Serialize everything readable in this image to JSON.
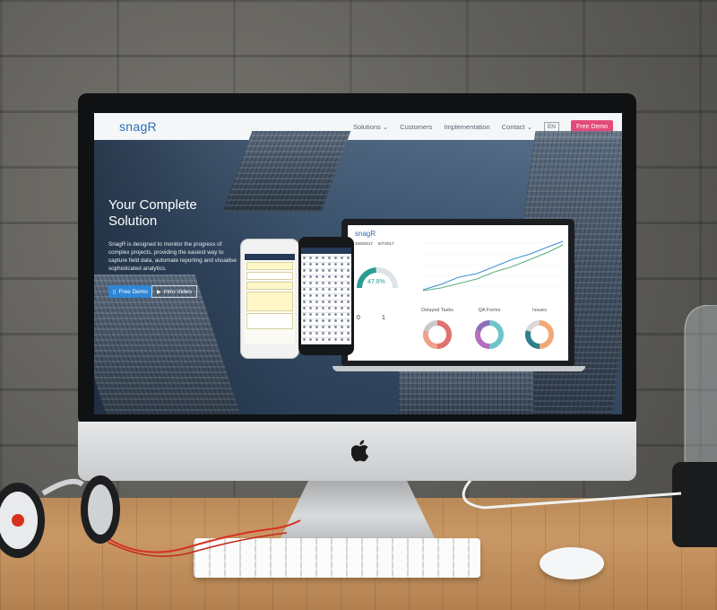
{
  "site": {
    "logo": "snagR",
    "nav": {
      "solutions": "Solutions ⌄",
      "customers": "Customers",
      "implementation": "Implementation",
      "contact": "Contact ⌄",
      "lang": "EN",
      "free_demo": "Free Demo"
    },
    "hero": {
      "title": "Your Complete Solution",
      "description": "SnagR is designed to monitor the progress of complex projects, providing the easiest way to capture field data, automate reporting and visualise sophisticated analytics.",
      "btn_demo": "Free Demo",
      "btn_video": "Intro Video"
    },
    "dashboard": {
      "logo": "snagR",
      "date_left": "26/8/2017",
      "date_right": "8/7/2017",
      "gauge_value": "47.8%",
      "gauge_percent": 47.8,
      "count_left": "0",
      "count_right": "1",
      "donuts": [
        {
          "title": "Delayed Tasks",
          "colors": [
            "#e0736f",
            "#f0a08a",
            "#c9c9c9"
          ]
        },
        {
          "title": "QA Forms",
          "colors": [
            "#6fc4c9",
            "#b36fbd",
            "#8f6fb3"
          ]
        },
        {
          "title": "Issues",
          "colors": [
            "#f2a777",
            "#30808c",
            "#d9d9d9"
          ]
        }
      ]
    }
  },
  "colors": {
    "brand_blue": "#2a6fb5",
    "accent_pink": "#e34a7a",
    "btn_blue": "#2f86d6"
  },
  "icons": {
    "apple": "apple-logo-icon",
    "phone": "phone-icon",
    "play": "play-icon"
  }
}
